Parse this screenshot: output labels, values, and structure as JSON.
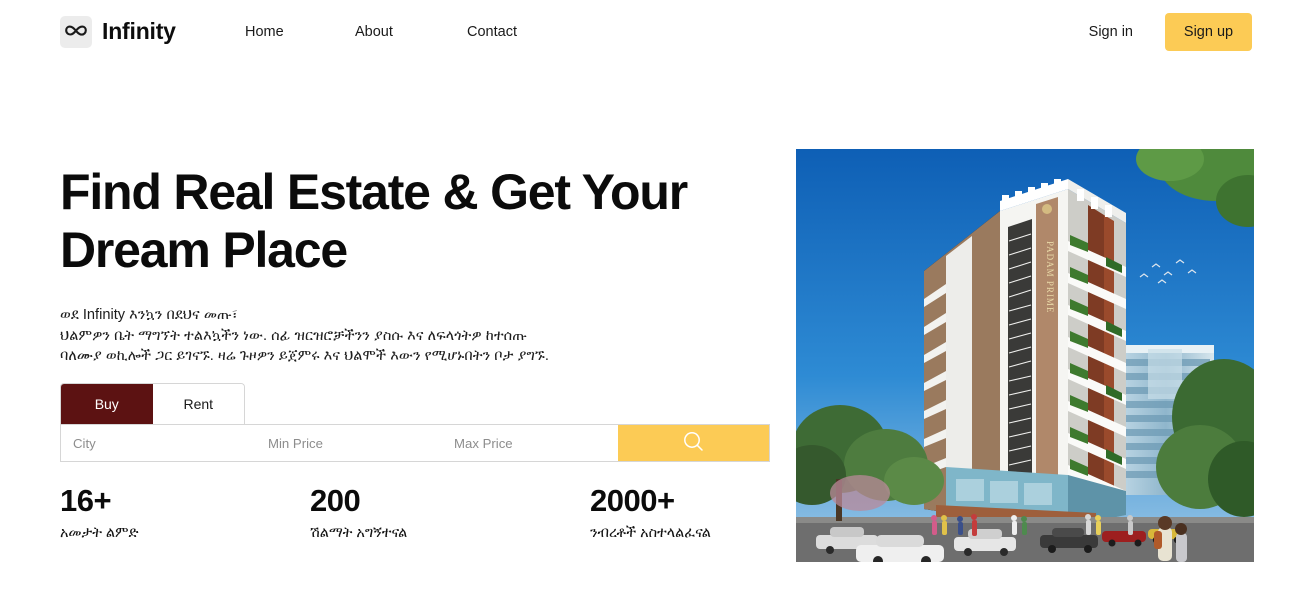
{
  "navbar": {
    "logo_icon": "infinity-icon",
    "brand": "Infinity",
    "links": [
      {
        "label": "Home"
      },
      {
        "label": "About"
      },
      {
        "label": "Contact"
      }
    ],
    "signin_label": "Sign in",
    "signup_label": "Sign up",
    "signup_bg": "#FCCB55"
  },
  "hero": {
    "title": "Find Real Estate & Get Your Dream Place",
    "description_lines": [
      "ወደ Infinity እንኳን በደህና መጡ፣",
      "ህልምዎን ቤት ማግኘት ተልእኳችን ነው. ሰፊ ዝርዝሮቻችንን ያስሱ እና ለፍላጎትዎ ከተሰጡ",
      "ባለሙያ ወኪሎች ጋር ይገናኙ. ዛሬ ጉዞዎን ይጀምሩ እና ህልሞች እውን የሚሆኑበትን ቦታ ያግኙ."
    ]
  },
  "search": {
    "tabs": [
      {
        "label": "Buy",
        "active": true
      },
      {
        "label": "Rent",
        "active": false
      }
    ],
    "active_tab_bg": "#5C1212",
    "city_placeholder": "City",
    "city_value": "",
    "min_price_placeholder": "Min Price",
    "min_price_value": "",
    "max_price_placeholder": "Max Price",
    "max_price_value": "",
    "search_icon": "magnifier-icon",
    "search_btn_bg": "#FCCB55"
  },
  "stats": [
    {
      "value": "16+",
      "label": "አመታት ልምድ"
    },
    {
      "value": "200",
      "label": "ሽልማት አግኝተናል"
    },
    {
      "value": "2000+",
      "label": "ንብረቶች አስተላልፈናል"
    }
  ],
  "hero_image": {
    "alt": "PADAM PRIME high-rise residential building exterior render",
    "building_sign": "PADAM PRIME",
    "sky_color": "#1A6FBE",
    "facade_color": "#B08A6A"
  }
}
